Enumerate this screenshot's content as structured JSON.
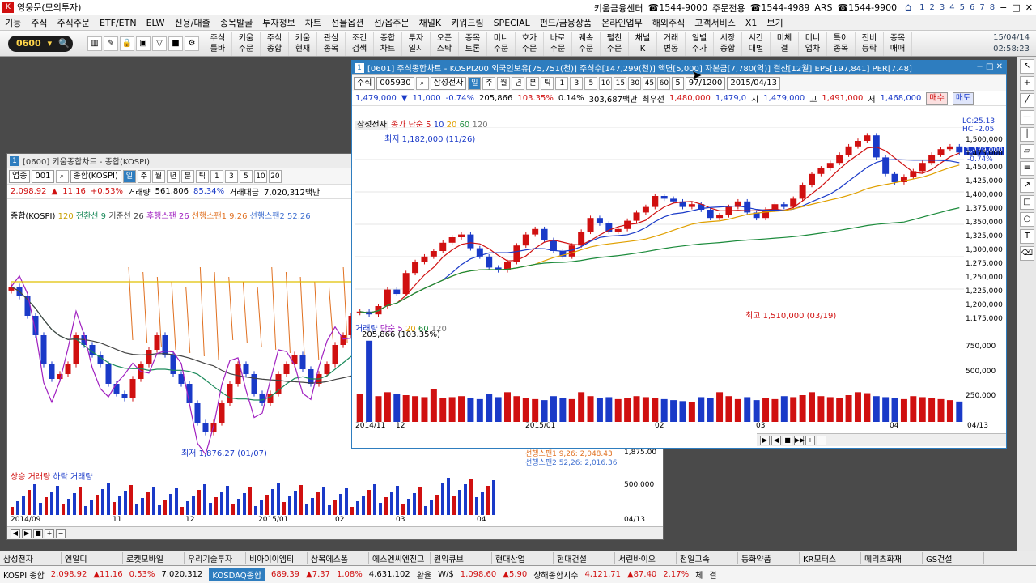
{
  "app": {
    "title": "영웅문(모의투자)",
    "contacts": [
      "키움금융센터",
      "☎1544-9000",
      "주문전용",
      "☎1544-4989",
      "ARS",
      "☎1544-9900"
    ],
    "screens": [
      "1",
      "2",
      "3",
      "4",
      "5",
      "6",
      "7",
      "8"
    ]
  },
  "menu": [
    "기능",
    "주식",
    "주식주문",
    "ETF/ETN",
    "ELW",
    "신용/대출",
    "종목발굴",
    "투자정보",
    "차트",
    "선물옵션",
    "선/옵주문",
    "채널K",
    "키워드림",
    "SPECIAL",
    "펀드/금융상품",
    "온라인업무",
    "해외주식",
    "고객서비스",
    "X1",
    "보기"
  ],
  "toolbar": {
    "screen_code": "0600",
    "buttons": [
      [
        "주식",
        "틀바"
      ],
      [
        "키움",
        "주문"
      ],
      [
        "주식",
        "종합"
      ],
      [
        "키움",
        "현재"
      ],
      [
        "관심",
        "종목"
      ],
      [
        "조건",
        "검색"
      ],
      [
        "종합",
        "차트"
      ],
      [
        "투자",
        "일지"
      ],
      [
        "오픈",
        "스탁"
      ],
      [
        "종목",
        "토론"
      ],
      [
        "미니",
        "주문"
      ],
      [
        "호가",
        "주문"
      ],
      [
        "바로",
        "주문"
      ],
      [
        "궤속",
        "주문"
      ],
      [
        "펼친",
        "주문"
      ],
      [
        "채널",
        "K"
      ],
      [
        "거래",
        "변동"
      ],
      [
        "일별",
        "주가"
      ],
      [
        "시장",
        "종합"
      ],
      [
        "시간",
        "대별"
      ],
      [
        "미체",
        "결"
      ],
      [
        "미니",
        "업차"
      ],
      [
        "특이",
        "종목"
      ],
      [
        "전비",
        "등락"
      ],
      [
        "종목",
        "매매"
      ]
    ],
    "date": "15/04/14",
    "time": "02:58:23"
  },
  "win_back": {
    "title": "[0600] 키움종합차트 - 종합(KOSPI)",
    "type": "업종",
    "code": "001",
    "name": "종합(KOSPI)",
    "periods": [
      "일",
      "주",
      "월",
      "년",
      "분",
      "틱"
    ],
    "sel": "일",
    "nums": [
      "1",
      "3",
      "5",
      "10",
      "20"
    ],
    "quote": {
      "price": "2,098.92",
      "arrow": "▲",
      "change": "11.16",
      "rate": "+0.53%",
      "vol_label": "거래량",
      "volume": "561,806",
      "ratio": "85.34%",
      "amt_label": "거래대금",
      "amount": "7,020,312백만"
    },
    "ichimoku": [
      "종합(KOSPI)",
      "120",
      "전환선 9",
      "기준선 26",
      "후행스팬 26",
      "선행스팬1 9,26",
      "선행스팬2 52,26"
    ],
    "low_label": "최저 1,876.27 (01/07)",
    "span1": "선행스팬1 9,26: 2,048.43",
    "span2": "선행스팬2 52,26: 2,016.36",
    "y_label": "1,875.00",
    "vol_title": [
      "상승 거래량",
      "하락 거래량"
    ],
    "vol_axis": "500,000",
    "dates": [
      "2014/09",
      "11",
      "12",
      "2015/01",
      "02",
      "03",
      "04"
    ],
    "last_date": "04/13"
  },
  "win_front": {
    "title": "[0601] 주식종합차트 - KOSPI200 외국인보유[75,751(천)] 주식수[147,299(천)] 액면[5,000] 자본금[7,780(억)] 결산[12월] EPS[197,841] PER[7.48]",
    "type": "주식",
    "code": "005930",
    "name": "삼성전자",
    "periods": [
      "일",
      "주",
      "월",
      "년",
      "분",
      "틱"
    ],
    "sel": "일",
    "nums": [
      "1",
      "3",
      "5",
      "10",
      "15",
      "30",
      "45",
      "60"
    ],
    "count": "5",
    "range": "97/1200",
    "date": "2015/04/13",
    "quote": {
      "price": "1,479,000",
      "arrow": "▼",
      "change": "11,000",
      "rate": "-0.74%",
      "volume": "205,866",
      "ratio": "103.35%",
      "turn": "0.14%",
      "amount": "303,687백만",
      "best_label": "최우선",
      "best": "1,480,000",
      "best2": "1,479,0",
      "open_l": "시",
      "open": "1,479,000",
      "high_l": "고",
      "high": "1,491,000",
      "low_l": "저",
      "low": "1,468,000",
      "buy": "매수",
      "sell": "매도"
    },
    "legend": [
      "삼성전자",
      "종가 단순 5",
      "10",
      "20",
      "60",
      "120"
    ],
    "low_label": "최저 1,182,000 (11/26)",
    "high_label": "최고 1,510,000 (03/19)",
    "lc": "LC:25.13",
    "hc": "HC:-2.05",
    "last_price": "1,479,000",
    "last_rate": "-0.74%",
    "vol_legend": [
      "거래량",
      "단순 5",
      "20",
      "60",
      "120"
    ],
    "vol_value": "205,866",
    "vol_ratio": "(103.35%)",
    "vol_axis": [
      "750,000",
      "500,000",
      "250,000"
    ],
    "dates": [
      "2014/11",
      "12",
      "2015/01",
      "02",
      "03",
      "04"
    ],
    "last_date": "04/13"
  },
  "stocks": [
    "삼성전자",
    "엔알디",
    "로켓모바일",
    "우리기술투자",
    "비아이이엠티",
    "삼목에스폼",
    "에스엔씨엔진그",
    "원익큐브",
    "현대산업",
    "현대건설",
    "서린바이오",
    "천일고속",
    "동화약품",
    "KR모터스",
    "메리츠화재",
    "GS건설"
  ],
  "indices": {
    "kospi_l": "KOSPI 종합",
    "kospi": "2,098.92",
    "kospi_c": "▲11.16",
    "kospi_r": "0.53%",
    "kospi_a": "7,020,312",
    "kosdaq_l": "KOSDAQ종합",
    "kosdaq": "689.39",
    "kosdaq_c": "▲7.37",
    "kosdaq_r": "1.08%",
    "kosdaq_a": "4,631,102",
    "fx_l": "환율",
    "fx_s": "W/$",
    "fx": "1,098.60",
    "fx_c": "▲5.90",
    "sh_l": "상해종합지수",
    "sh": "4,121.71",
    "sh_c": "▲87.40",
    "sh_r": "2.17%",
    "tail": "체",
    "tail2": "결"
  },
  "chart_data": [
    {
      "type": "candlestick",
      "title": "삼성전자",
      "series": [
        {
          "name": "삼성전자",
          "close": [
            1190000,
            1185000,
            1200000,
            1230000,
            1222000,
            1260000,
            1280000,
            1290000,
            1300000,
            1315000,
            1325000,
            1330000,
            1305000,
            1290000,
            1270000,
            1265000,
            1280000,
            1310000,
            1330000,
            1340000,
            1320000,
            1300000,
            1290000,
            1310000,
            1335000,
            1360000,
            1350000,
            1335000,
            1340000,
            1355000,
            1370000,
            1380000,
            1400000,
            1395000,
            1390000,
            1380000,
            1385000,
            1375000,
            1360000,
            1365000,
            1380000,
            1390000,
            1370000,
            1360000,
            1375000,
            1385000,
            1380000,
            1395000,
            1420000,
            1440000,
            1450000,
            1460000,
            1475000,
            1490000,
            1500000,
            1510000,
            1470000,
            1440000,
            1425000,
            1435000,
            1445000,
            1460000,
            1475000,
            1485000,
            1490000,
            1479000
          ]
        }
      ],
      "volume": [
        280000,
        820000,
        260000,
        300000,
        280000,
        270000,
        260000,
        250000,
        330000,
        240000,
        250000,
        260000,
        240000,
        230000,
        280000,
        250000,
        300000,
        260000,
        240000,
        230000,
        220000,
        260000,
        240000,
        230000,
        300000,
        260000,
        240000,
        250000,
        230000,
        240000,
        260000,
        250000,
        240000,
        230000,
        220000,
        210000,
        200000,
        250000,
        240000,
        300000,
        260000,
        230000,
        250000,
        220000,
        240000,
        230000,
        260000,
        250000,
        270000,
        300000,
        260000,
        250000,
        240000,
        270000,
        300000,
        290000,
        260000,
        250000,
        240000,
        230000,
        260000,
        250000,
        240000,
        230000,
        220000,
        205866
      ],
      "ylim": [
        1175000,
        1525000
      ],
      "vol_ylim": [
        0,
        900000
      ],
      "xticks": [
        "2014/11",
        "12",
        "2015/01",
        "02",
        "03",
        "04"
      ]
    },
    {
      "type": "candlestick",
      "title": "종합(KOSPI)",
      "series": [
        {
          "name": "종합(KOSPI)",
          "close": [
            2040,
            2030,
            2010,
            1990,
            1960,
            1945,
            1950,
            1960,
            1990,
            1980,
            1970,
            1960,
            1940,
            1930,
            1925,
            1945,
            1960,
            1975,
            1990,
            1970,
            1950,
            1940,
            1920,
            1900,
            1890,
            1900,
            1920,
            1940,
            1960,
            1950,
            1930,
            1920,
            1930,
            1950,
            1960,
            1970,
            1955,
            1940,
            1950,
            1960,
            1980,
            1990,
            2010
          ]
        }
      ],
      "ylim": [
        1860,
        2110
      ],
      "xticks": [
        "2014/09",
        "11",
        "12",
        "2015/01",
        "02",
        "03",
        "04"
      ]
    }
  ]
}
